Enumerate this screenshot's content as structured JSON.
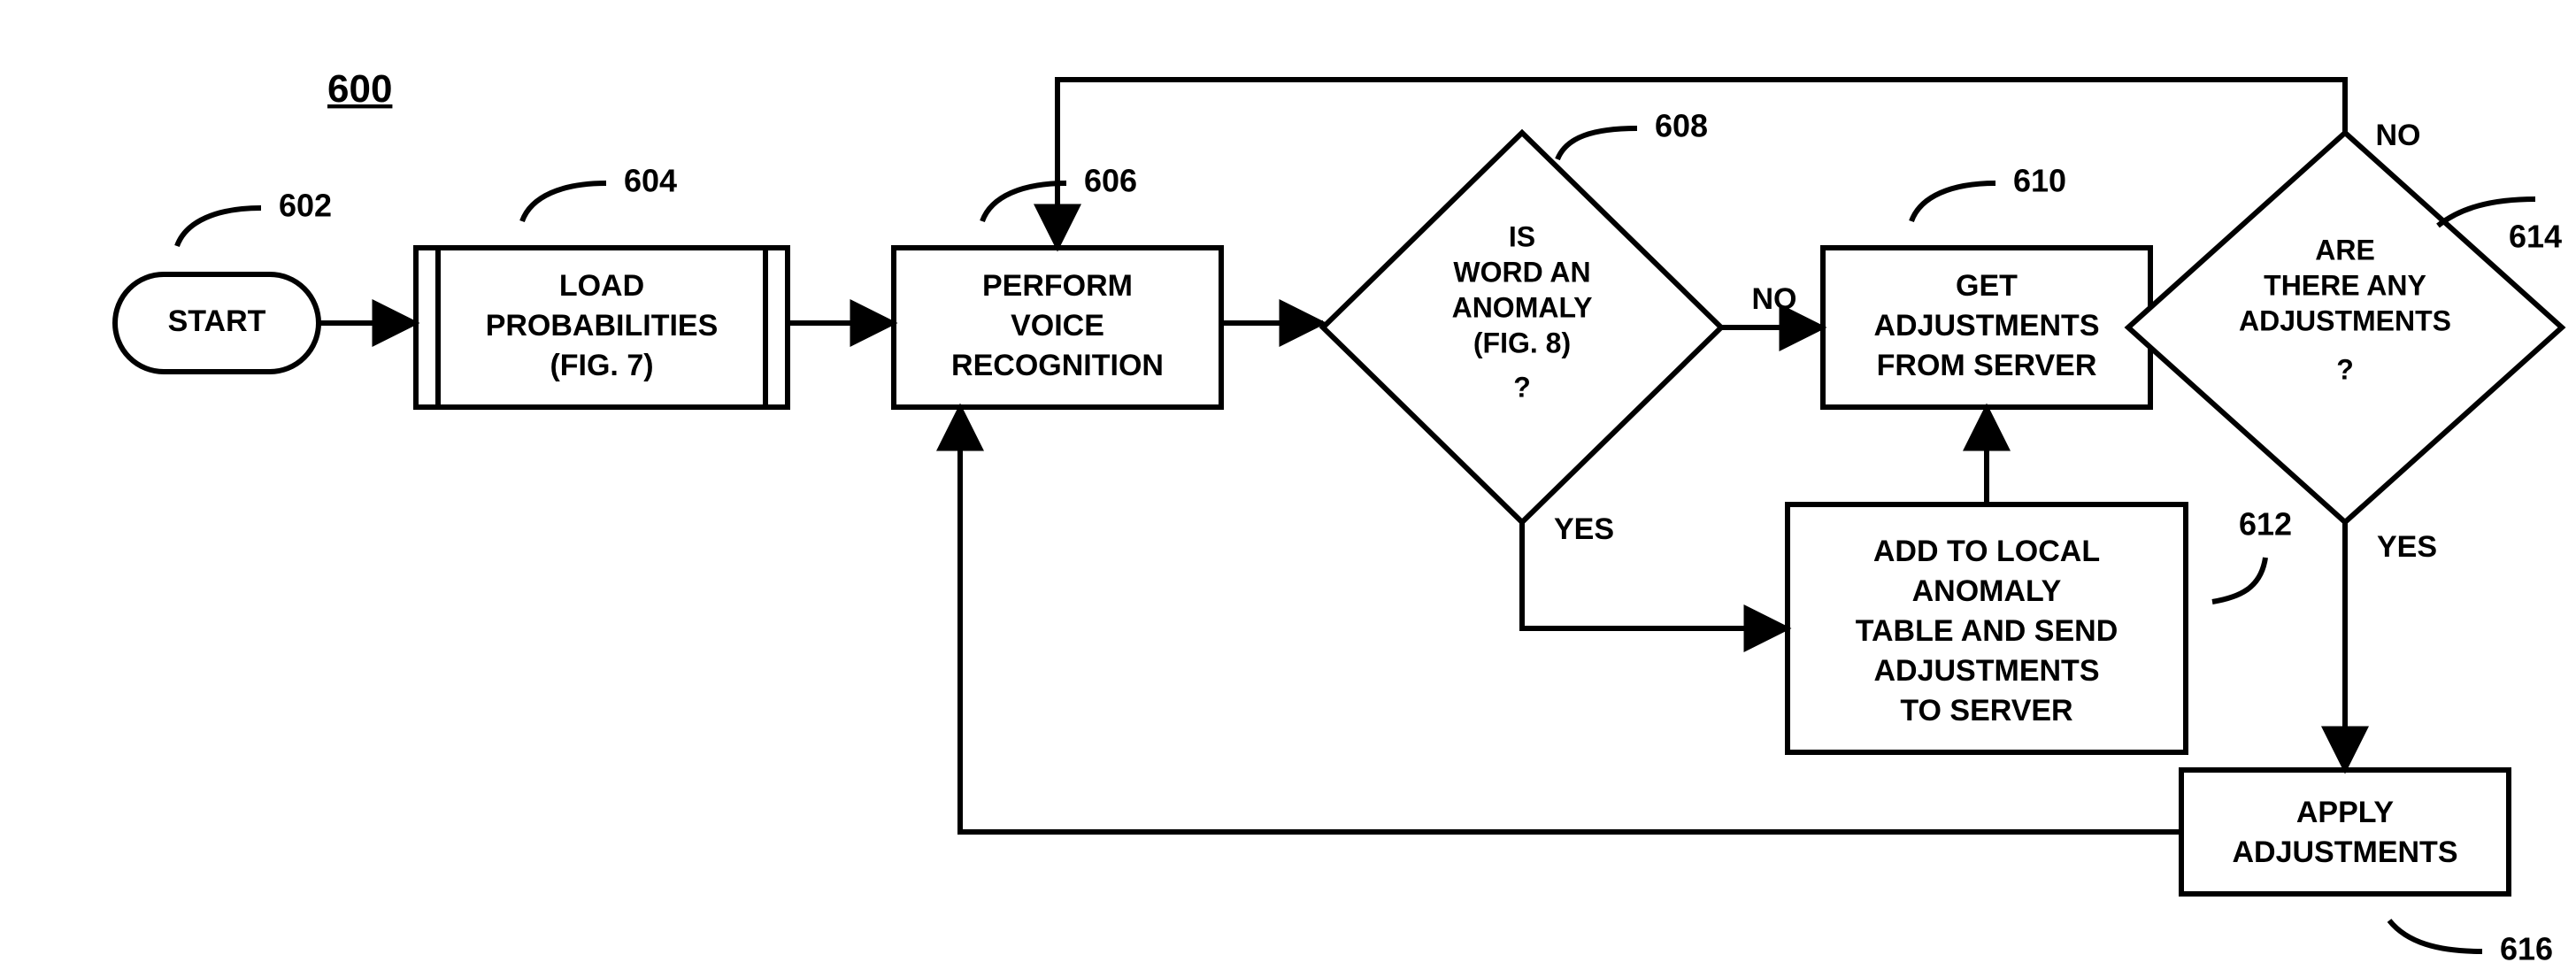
{
  "chart_data": {
    "type": "flowchart",
    "figure_number": "600",
    "nodes": [
      {
        "id": "602",
        "label": "602",
        "type": "terminator",
        "text": [
          "START"
        ]
      },
      {
        "id": "604",
        "label": "604",
        "type": "subprocess",
        "text": [
          "LOAD",
          "PROBABILITIES",
          "(FIG. 7)"
        ]
      },
      {
        "id": "606",
        "label": "606",
        "type": "process",
        "text": [
          "PERFORM",
          "VOICE",
          "RECOGNITION"
        ]
      },
      {
        "id": "608",
        "label": "608",
        "type": "decision",
        "text": [
          "IS",
          "WORD AN",
          "ANOMALY",
          "(FIG. 8)",
          "?"
        ]
      },
      {
        "id": "610",
        "label": "610",
        "type": "process",
        "text": [
          "GET",
          "ADJUSTMENTS",
          "FROM SERVER"
        ]
      },
      {
        "id": "612",
        "label": "612",
        "type": "process",
        "text": [
          "ADD TO LOCAL",
          "ANOMALY",
          "TABLE AND SEND",
          "ADJUSTMENTS",
          "TO SERVER"
        ]
      },
      {
        "id": "614",
        "label": "614",
        "type": "decision",
        "text": [
          "ARE",
          "THERE ANY",
          "ADJUSTMENTS",
          "?"
        ]
      },
      {
        "id": "616",
        "label": "616",
        "type": "process",
        "text": [
          "APPLY",
          "ADJUSTMENTS"
        ]
      }
    ],
    "edges": [
      {
        "from": "602",
        "to": "604",
        "label": ""
      },
      {
        "from": "604",
        "to": "606",
        "label": ""
      },
      {
        "from": "606",
        "to": "608",
        "label": ""
      },
      {
        "from": "608",
        "to": "610",
        "label": "NO"
      },
      {
        "from": "608",
        "to": "612",
        "label": "YES"
      },
      {
        "from": "612",
        "to": "610",
        "label": ""
      },
      {
        "from": "610",
        "to": "614",
        "label": ""
      },
      {
        "from": "614",
        "to": "606",
        "label": "NO"
      },
      {
        "from": "614",
        "to": "616",
        "label": "YES"
      },
      {
        "from": "616",
        "to": "606",
        "label": ""
      }
    ]
  }
}
